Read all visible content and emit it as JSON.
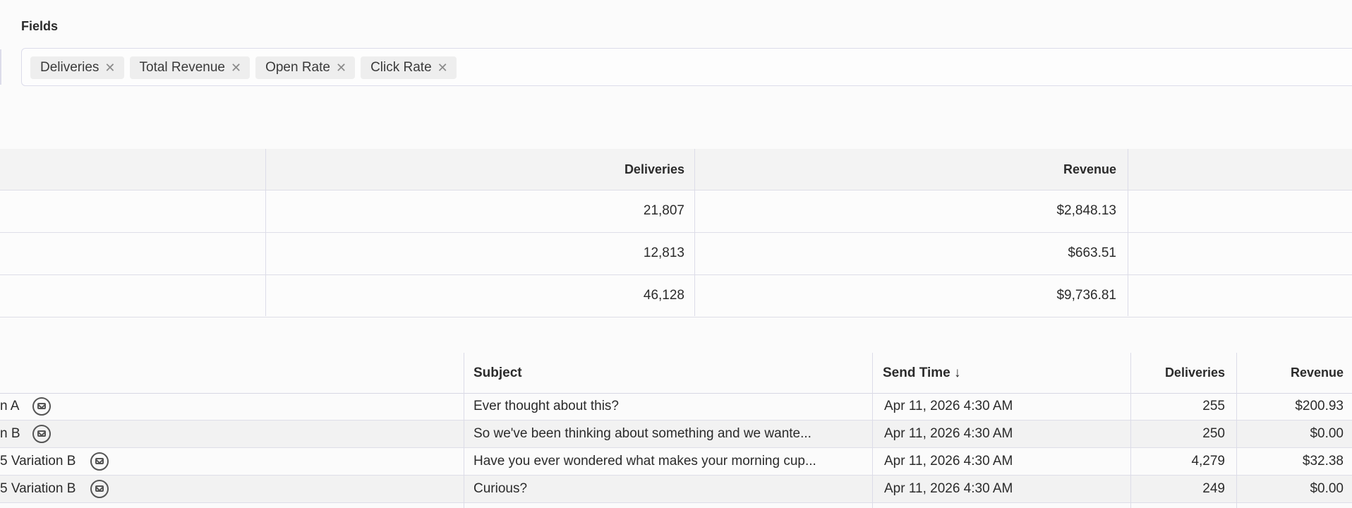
{
  "fields": {
    "label": "Fields",
    "chips": [
      {
        "label": "Deliveries"
      },
      {
        "label": "Total Revenue"
      },
      {
        "label": "Open Rate"
      },
      {
        "label": "Click Rate"
      }
    ],
    "remove_glyph": "✕"
  },
  "summary_table": {
    "headers": {
      "deliveries": "Deliveries",
      "revenue": "Revenue"
    },
    "rows": [
      {
        "deliveries": "21,807",
        "revenue": "$2,848.13"
      },
      {
        "deliveries": "12,813",
        "revenue": "$663.51"
      },
      {
        "deliveries": "46,128",
        "revenue": "$9,736.81"
      }
    ]
  },
  "detail_table": {
    "headers": {
      "subject": "Subject",
      "send_time": "Send Time ↓",
      "deliveries": "Deliveries",
      "revenue": "Revenue"
    },
    "rows": [
      {
        "name": "n A",
        "subject": "Ever thought about this?",
        "send_time": "Apr 11, 2026 4:30 AM",
        "deliveries": "255",
        "revenue": "$200.93"
      },
      {
        "name": "n B",
        "subject": "So we've been thinking about something and we wante...",
        "send_time": "Apr 11, 2026 4:30 AM",
        "deliveries": "250",
        "revenue": "$0.00"
      },
      {
        "name": "5 Variation B",
        "subject": "Have you ever wondered what makes your morning cup...",
        "send_time": "Apr 11, 2026 4:30 AM",
        "deliveries": "4,279",
        "revenue": "$32.38"
      },
      {
        "name": "5 Variation B",
        "subject": "Curious?",
        "send_time": "Apr 11, 2026 4:30 AM",
        "deliveries": "249",
        "revenue": "$0.00"
      }
    ]
  }
}
